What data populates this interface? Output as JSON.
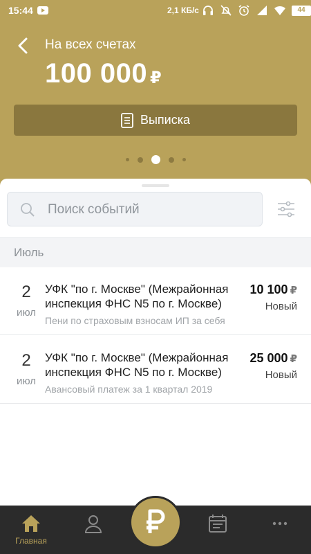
{
  "status_bar": {
    "time": "15:44",
    "network_speed": "2,1 КБ/с",
    "battery": "44",
    "icons": [
      "youtube-icon",
      "headphones-icon",
      "mute-icon",
      "alarm-icon",
      "signal-icon",
      "wifi-icon",
      "battery-icon"
    ]
  },
  "header": {
    "title": "На всех счетах",
    "balance": "100 000",
    "currency": "₽",
    "statement_label": "Выписка",
    "accent_color": "#b9a25a",
    "button_color": "#8a773e"
  },
  "search": {
    "placeholder": "Поиск событий"
  },
  "month_label": "Июль",
  "events": [
    {
      "day": "2",
      "month": "июл",
      "title": "УФК \"по г. Москве\" (Межрайонная инспекция ФНС N5 по г. Москве)",
      "description": "Пени по страховым взносам ИП за себя",
      "amount": "10 100",
      "currency": "₽",
      "status": "Новый"
    },
    {
      "day": "2",
      "month": "июл",
      "title": "УФК \"по г. Москве\" (Межрайонная инспекция ФНС N5 по г. Москве)",
      "description": "Авансовый платеж за 1 квартал 2019",
      "amount": "25 000",
      "currency": "₽",
      "status": "Новый"
    }
  ],
  "tabbar": {
    "home_label": "Главная",
    "tabs": [
      "home-icon",
      "profile-icon",
      "ruble-icon",
      "calendar-icon",
      "more-icon"
    ]
  }
}
